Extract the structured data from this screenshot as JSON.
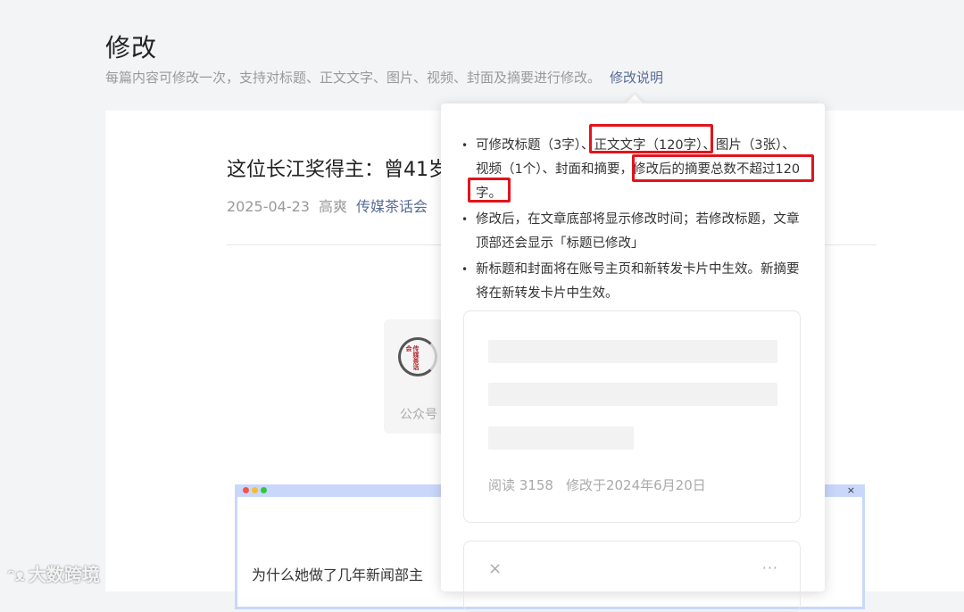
{
  "header": {
    "title": "修改",
    "subtitle": "每篇内容可修改一次，支持对标题、正文文字、图片、视频、封面及摘要进行修改。",
    "help_link": "修改说明"
  },
  "article": {
    "title": "这位长江奖得主：曾41岁",
    "date": "2025-04-23",
    "author": "高爽",
    "account": "传媒茶话会",
    "profile_label": "公众号",
    "logo_text": "传媒茶话会",
    "preview_text": "为什么她做了几年新闻部主"
  },
  "window": {
    "dot_colors": [
      "#f5504b",
      "#f5bd2d",
      "#2cc840"
    ],
    "close": "×"
  },
  "popover": {
    "rules": [
      "可修改标题（3字）、正文文字（120字）、图片（3张）、视频（1个）、封面和摘要，修改后的摘要总数不超过120字。",
      "修改后，在文章底部将显示修改时间；若修改标题，文章顶部还会显示「标题已修改」",
      "新标题和封面将在账号主页和新转发卡片中生效。新摘要将在新转发卡片中生效。"
    ],
    "demo": {
      "read_count": "阅读 3158",
      "modified_date": "修改于2024年6月20日"
    },
    "demo2": {
      "close_icon": "×",
      "more_icon": "···"
    },
    "highlight_color": "#e2141b"
  },
  "watermark": {
    "text": "大数跨境"
  }
}
